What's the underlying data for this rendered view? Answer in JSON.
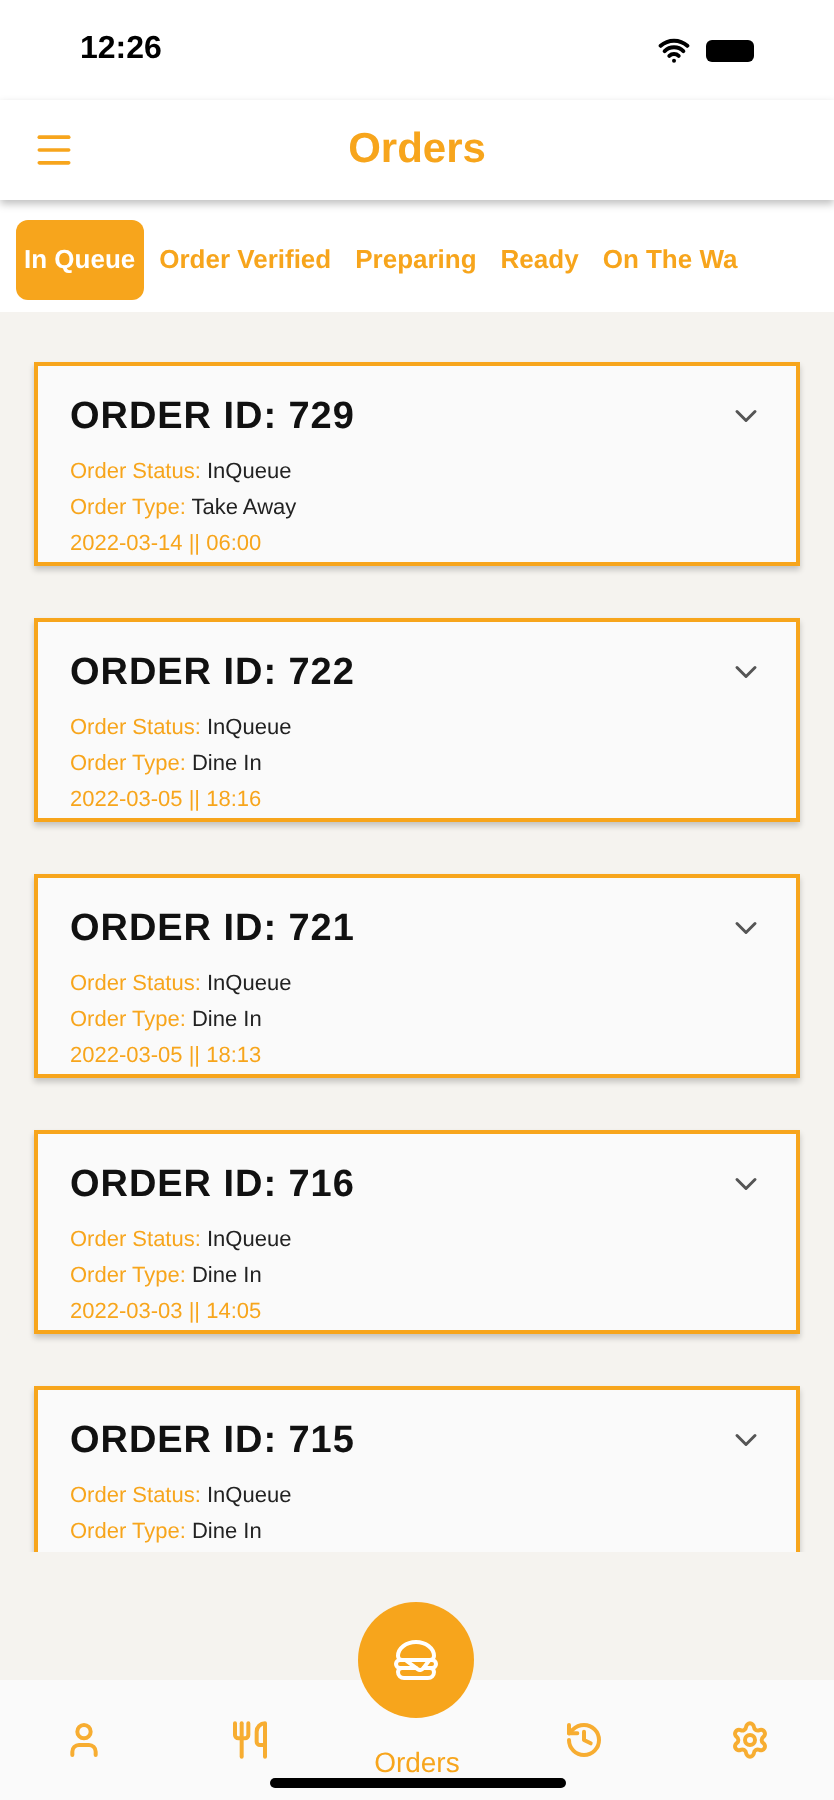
{
  "status_bar": {
    "time": "12:26"
  },
  "header": {
    "title": "Orders"
  },
  "tabs": [
    {
      "label": "In Queue",
      "selected": true
    },
    {
      "label": "Order Verified",
      "selected": false
    },
    {
      "label": "Preparing",
      "selected": false
    },
    {
      "label": "Ready",
      "selected": false
    },
    {
      "label": "On The Wa",
      "selected": false
    }
  ],
  "orders": [
    {
      "title": "ORDER ID: 729",
      "status_label": "Order Status:",
      "status": "InQueue",
      "type_label": "Order Type:",
      "type": "Take Away",
      "datetime": "2022-03-14 || 06:00"
    },
    {
      "title": "ORDER ID: 722",
      "status_label": "Order Status:",
      "status": "InQueue",
      "type_label": "Order Type:",
      "type": "Dine In",
      "datetime": "2022-03-05 || 18:16"
    },
    {
      "title": "ORDER ID: 721",
      "status_label": "Order Status:",
      "status": "InQueue",
      "type_label": "Order Type:",
      "type": "Dine In",
      "datetime": "2022-03-05 || 18:13"
    },
    {
      "title": "ORDER ID: 716",
      "status_label": "Order Status:",
      "status": "InQueue",
      "type_label": "Order Type:",
      "type": "Dine In",
      "datetime": "2022-03-03 || 14:05"
    },
    {
      "title": "ORDER ID: 715",
      "status_label": "Order Status:",
      "status": "InQueue",
      "type_label": "Order Type:",
      "type": "Dine In"
    }
  ],
  "bottom_nav": [
    {
      "kind": "profile",
      "selected": false
    },
    {
      "kind": "menu",
      "selected": false
    },
    {
      "kind": "orders",
      "label": "Orders",
      "selected": true
    },
    {
      "kind": "history",
      "selected": false
    },
    {
      "kind": "settings",
      "selected": false
    }
  ]
}
